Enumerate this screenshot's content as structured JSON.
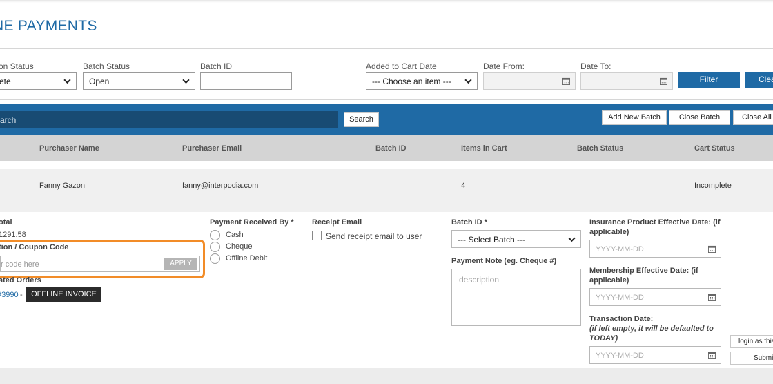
{
  "page": {
    "title": "NE PAYMENTS"
  },
  "filters": {
    "option_status": {
      "label": "on Status",
      "value": "ete"
    },
    "batch_status": {
      "label": "Batch Status",
      "value": "Open"
    },
    "batch_id": {
      "label": "Batch ID",
      "value": ""
    },
    "added_to_cart_date": {
      "label": "Added to Cart Date",
      "value": "--- Choose an item ---"
    },
    "date_from": {
      "label": "Date From:",
      "value": ""
    },
    "date_to": {
      "label": "Date To:",
      "value": ""
    },
    "filter_button": "Filter",
    "clear_button": "Clea"
  },
  "toolbar": {
    "search_placeholder": "arch",
    "search_button": "Search",
    "add_new_batch": "Add New Batch",
    "close_batch": "Close Batch",
    "close_all": "Close All B"
  },
  "table": {
    "columns": [
      "Purchaser Name",
      "Purchaser Email",
      "Batch ID",
      "Items in Cart",
      "Batch Status",
      "Cart Status"
    ],
    "rows": [
      {
        "purchaser_name": "Fanny Gazon",
        "purchaser_email": "fanny@interpodia.com",
        "batch_id": "",
        "items_in_cart": "4",
        "batch_status": "",
        "cart_status": "Incomplete"
      }
    ]
  },
  "detail": {
    "total_label": "otal",
    "total_value": "1291.58",
    "coupon_label": "tion / Coupon Code",
    "coupon_placeholder": "r code here",
    "apply_button": "APPLY",
    "related_orders_label": "ated Orders",
    "order_link": "#3990",
    "order_sep": "-",
    "offline_invoice": "OFFLINE INVOICE",
    "payment_received_by_label": "Payment Received By *",
    "payment_options": [
      "Cash",
      "Cheque",
      "Offline Debit"
    ],
    "receipt_email_label": "Receipt Email",
    "send_receipt_label": "Send receipt email to user",
    "batch_id_label": "Batch ID *",
    "batch_select_value": "--- Select Batch ---",
    "payment_note_label": "Payment Note (eg. Cheque #)",
    "payment_note_placeholder": "description",
    "insurance_date_label_1": "Insurance Product Effective Date: (if",
    "insurance_date_label_2": "applicable)",
    "membership_date_label_1": "Membership Effective Date: (if",
    "membership_date_label_2": "applicable)",
    "transaction_date_label": "Transaction Date:",
    "transaction_note_1": "(if left empty, it will be defaulted to",
    "transaction_note_2": "TODAY)",
    "date_placeholder": "YYYY-MM-DD",
    "login_as_button": "login as this",
    "submit_button": "Submi"
  },
  "icons": {
    "calendar": "calendar-icon",
    "chevron": "chevron-down-icon"
  },
  "colors": {
    "brand_blue": "#1f6aa5",
    "dark_blue": "#184b73",
    "highlight_orange": "#f28c28"
  }
}
